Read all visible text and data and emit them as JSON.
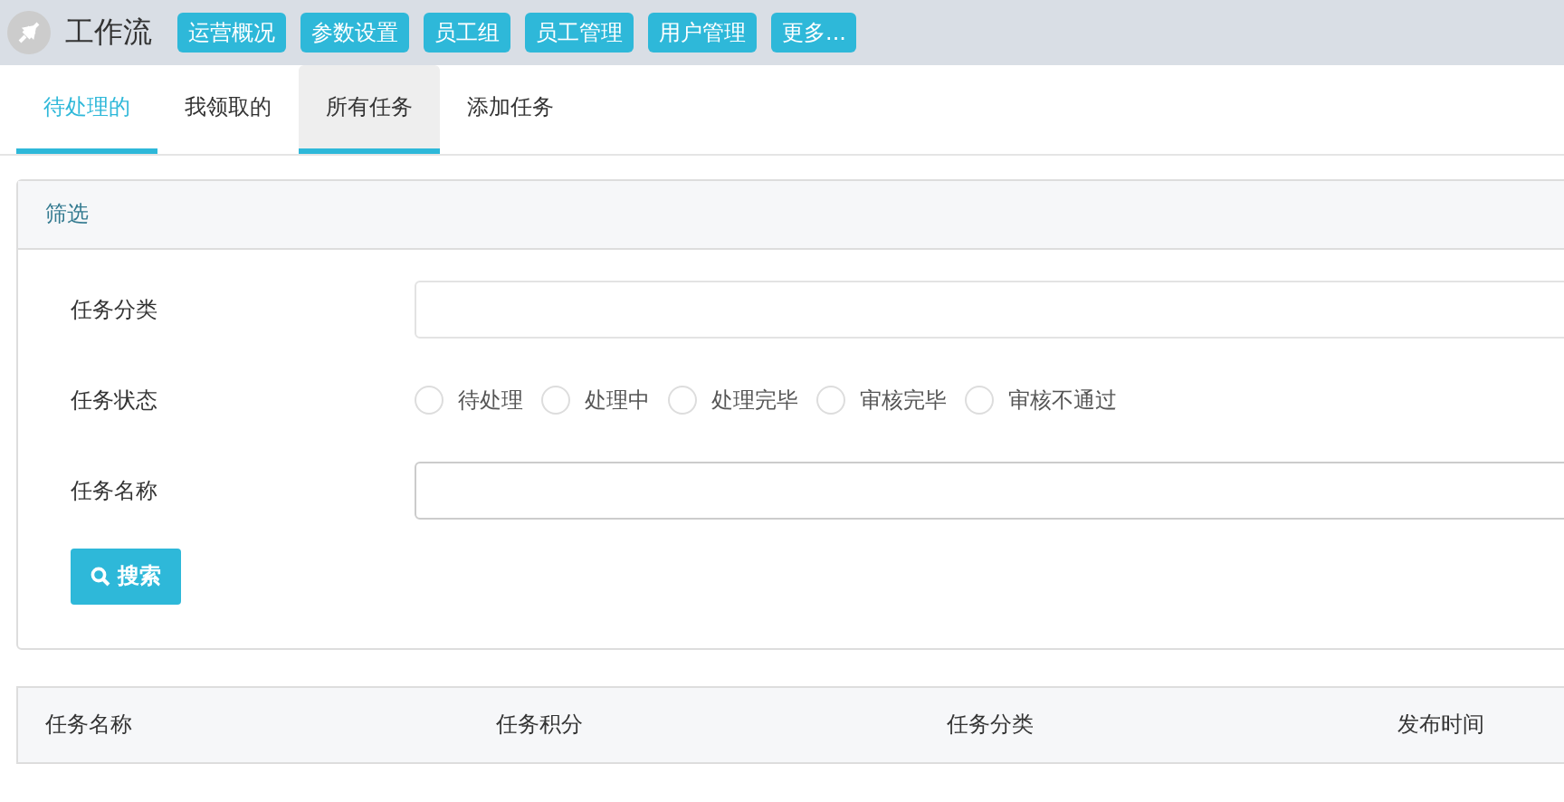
{
  "header": {
    "title": "工作流",
    "nav": [
      "运营概况",
      "参数设置",
      "员工组",
      "员工管理",
      "用户管理",
      "更多..."
    ]
  },
  "tabs": [
    {
      "label": "待处理的",
      "selected": true,
      "highlighted": false
    },
    {
      "label": "我领取的",
      "selected": false,
      "highlighted": false
    },
    {
      "label": "所有任务",
      "selected": false,
      "highlighted": true
    },
    {
      "label": "添加任务",
      "selected": false,
      "highlighted": false
    }
  ],
  "filter": {
    "title": "筛选",
    "fields": [
      {
        "kind": "input",
        "label": "任务分类"
      },
      {
        "kind": "radios",
        "label": "任务状态",
        "options": [
          {
            "label": "待处理",
            "selected": false
          },
          {
            "label": "处理中",
            "selected": false
          },
          {
            "label": "处理完毕",
            "selected": false
          },
          {
            "label": "审核完毕",
            "selected": false
          },
          {
            "label": "审核不通过",
            "selected": false
          }
        ]
      },
      {
        "kind": "input",
        "label": "任务名称"
      }
    ],
    "search_button": "搜索"
  },
  "table": {
    "columns": [
      "任务名称",
      "任务积分",
      "任务分类",
      "发布时间"
    ]
  }
}
